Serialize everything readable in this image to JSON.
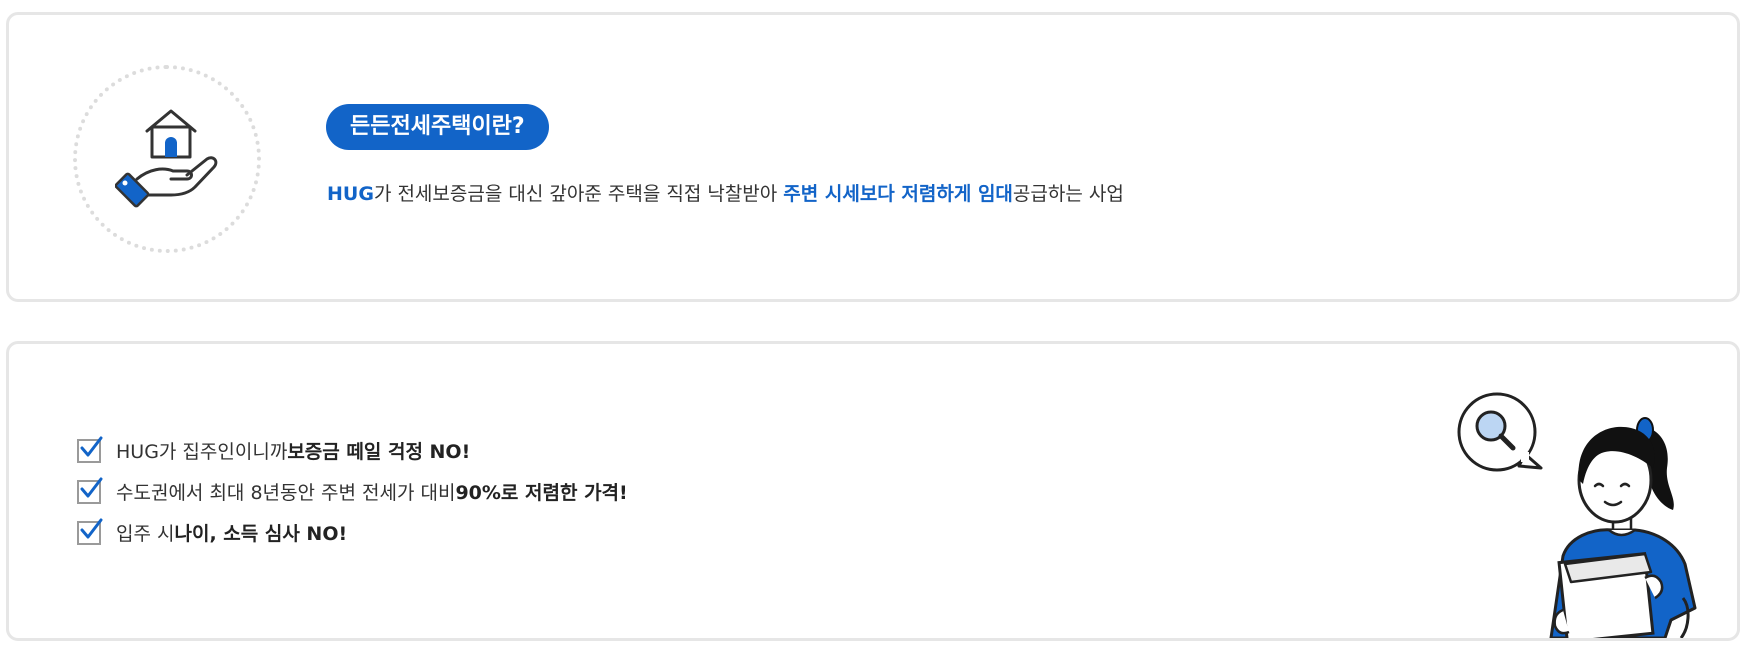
{
  "intro": {
    "title": "든든전세주택이란?",
    "desc_prefix_highlight": "HUG",
    "desc_middle": "가 전세보증금을 대신 갚아준 주택을 직접 낙찰받아 ",
    "desc_highlight": "주변 시세보다 저렴하게 임대",
    "desc_suffix": "공급하는 사업",
    "icon": "house-in-hand-icon"
  },
  "benefits": [
    {
      "normal": "HUG가 집주인이니까 ",
      "bold": "보증금 떼일 걱정 NO!"
    },
    {
      "normal": "수도권에서 최대 8년동안 주변 전세가 대비 ",
      "bold": "90%로 저렴한 가격!"
    },
    {
      "normal": "입주 시 ",
      "bold": "나이, 소득 심사 NO!"
    }
  ],
  "colors": {
    "accent": "#1264c8",
    "border": "#e6e6e6",
    "text": "#333333"
  },
  "illustration": "woman-reading-document-with-magnifier"
}
